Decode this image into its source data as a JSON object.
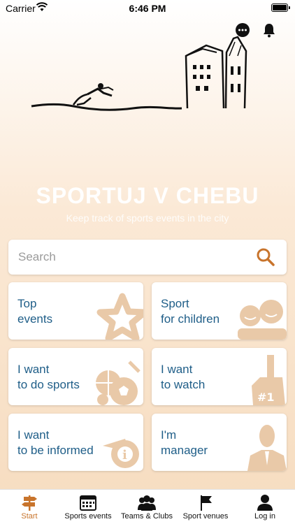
{
  "status_bar": {
    "carrier": "Carrier",
    "time": "6:46 PM"
  },
  "app": {
    "title": "SPORTUJ V CHEBU",
    "subtitle": "Keep track of sports events in the city"
  },
  "search": {
    "placeholder": "Search"
  },
  "tiles": [
    {
      "line1": "Top",
      "line2": "events",
      "icon": "star-icon"
    },
    {
      "line1": "Sport",
      "line2": "for children",
      "icon": "children-icon"
    },
    {
      "line1": "I want",
      "line2": "to do sports",
      "icon": "sports-balls-icon"
    },
    {
      "line1": "I want",
      "line2": "to watch",
      "icon": "foam-finger-icon"
    },
    {
      "line1": "I want",
      "line2": "to be informed",
      "icon": "whistle-info-icon"
    },
    {
      "line1": "I'm",
      "line2": "manager",
      "icon": "manager-icon"
    }
  ],
  "tabs": [
    {
      "label": "Start",
      "icon": "signpost-icon",
      "active": true
    },
    {
      "label": "Sports events",
      "icon": "calendar-icon"
    },
    {
      "label": "Teams & Clubs",
      "icon": "team-icon"
    },
    {
      "label": "Sport venues",
      "icon": "flag-icon"
    },
    {
      "label": "Log in",
      "icon": "user-icon"
    }
  ],
  "colors": {
    "accent": "#c8742c",
    "tile_text": "#1f5e88",
    "tile_art": "#e9c9a8"
  }
}
